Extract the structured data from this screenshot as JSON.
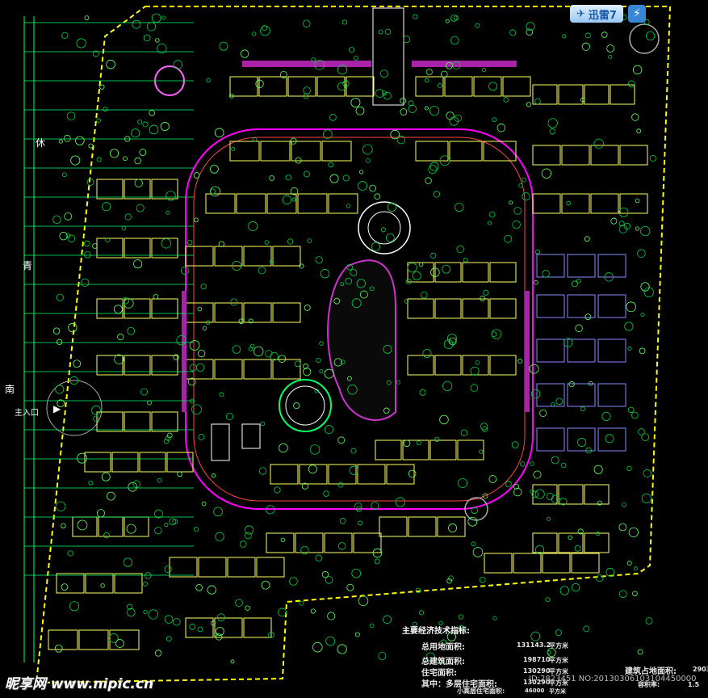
{
  "app": {
    "name": "迅雷7",
    "badge_icon": "thunder-bolt-icon"
  },
  "side_labels": {
    "label_1": "休",
    "label_2": "青",
    "label_3": "南",
    "entrance": "主入口"
  },
  "indicators": {
    "title": "主要经济技术指标:",
    "rows": [
      {
        "label": "总用地面积:",
        "value": "131143.2",
        "unit": "平方米"
      },
      {
        "label": "总建筑面积:",
        "value": "198710",
        "unit": "平方米"
      },
      {
        "label": "住宅面积:",
        "value": "130290",
        "unit": "平方米"
      },
      {
        "label": "其中：多层住宅面积:",
        "value": "130290",
        "unit": "平方米"
      },
      {
        "label": "小高层住宅面积:",
        "value": "46000",
        "unit": "平方米"
      }
    ],
    "building_area_label": "建筑占地面积:",
    "building_area_value": "2903",
    "far_label": "容积率:",
    "far_value": "1.5"
  },
  "watermark": {
    "site": "昵享网 www.nipic.cn",
    "id_text": "ID:2823451 NO:20130306103104450000"
  },
  "colors": {
    "background": "#000000",
    "road": "#ff00ff",
    "building": "#ffff66",
    "tree": "#00cc44",
    "grid": "#00ff66",
    "boundary": "#ffff00"
  }
}
